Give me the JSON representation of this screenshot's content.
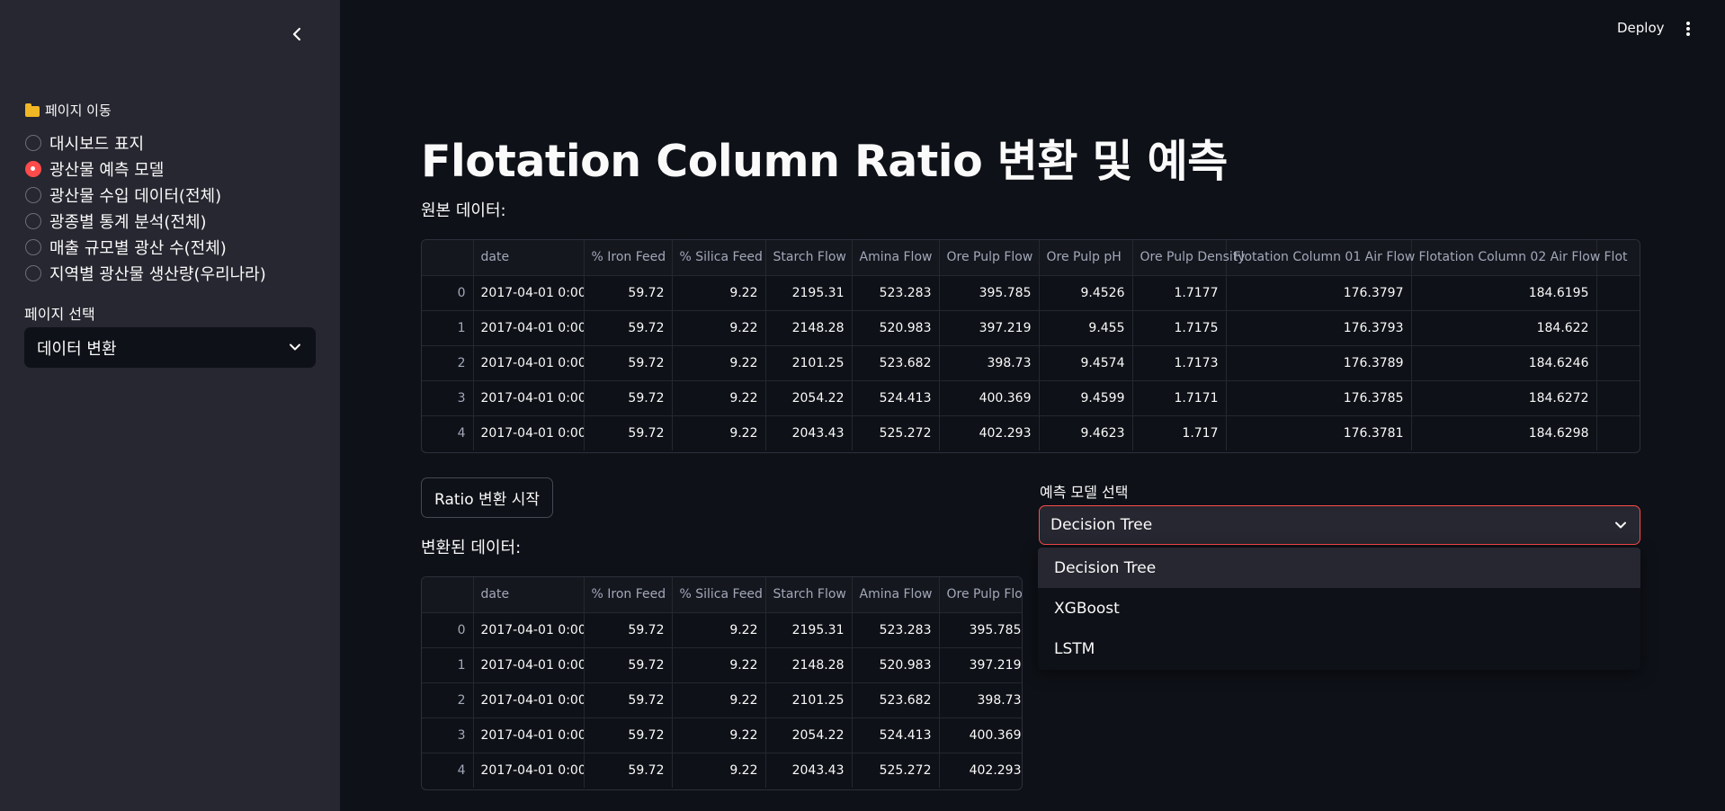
{
  "sidebar": {
    "nav_title": "페이지 이동",
    "radio_items": [
      {
        "label": "대시보드 표지",
        "selected": false
      },
      {
        "label": "광산물 예측 모델",
        "selected": true
      },
      {
        "label": "광산물 수입 데이터(전체)",
        "selected": false
      },
      {
        "label": "광종별 통계 분석(전체)",
        "selected": false
      },
      {
        "label": "매출 규모별 광산 수(전체)",
        "selected": false
      },
      {
        "label": "지역별 광산물 생산량(우리나라)",
        "selected": false
      }
    ],
    "page_select_label": "페이지 선택",
    "page_select_value": "데이터 변환"
  },
  "header": {
    "deploy_label": "Deploy"
  },
  "main": {
    "title": "Flotation Column Ratio 변환 및 예측",
    "original_label": "원본 데이터:",
    "original_table": {
      "columns": [
        "",
        "date",
        "% Iron Feed",
        "% Silica Feed",
        "Starch Flow",
        "Amina Flow",
        "Ore Pulp Flow",
        "Ore Pulp pH",
        "Ore Pulp Density",
        "Flotation Column 01 Air Flow",
        "Flotation Column 02 Air Flow",
        "Flot"
      ],
      "rows": [
        [
          "0",
          "2017-04-01 0:00",
          "59.72",
          "9.22",
          "2195.31",
          "523.283",
          "395.785",
          "9.4526",
          "1.7177",
          "176.3797",
          "184.6195",
          ""
        ],
        [
          "1",
          "2017-04-01 0:00",
          "59.72",
          "9.22",
          "2148.28",
          "520.983",
          "397.219",
          "9.455",
          "1.7175",
          "176.3793",
          "184.622",
          ""
        ],
        [
          "2",
          "2017-04-01 0:00",
          "59.72",
          "9.22",
          "2101.25",
          "523.682",
          "398.73",
          "9.4574",
          "1.7173",
          "176.3789",
          "184.6246",
          ""
        ],
        [
          "3",
          "2017-04-01 0:00",
          "59.72",
          "9.22",
          "2054.22",
          "524.413",
          "400.369",
          "9.4599",
          "1.7171",
          "176.3785",
          "184.6272",
          ""
        ],
        [
          "4",
          "2017-04-01 0:00",
          "59.72",
          "9.22",
          "2043.43",
          "525.272",
          "402.293",
          "9.4623",
          "1.717",
          "176.3781",
          "184.6298",
          ""
        ]
      ]
    },
    "ratio_button_label": "Ratio 변환 시작",
    "converted_label": "변환된 데이터:",
    "converted_table": {
      "columns": [
        "",
        "date",
        "% Iron Feed",
        "% Silica Feed",
        "Starch Flow",
        "Amina Flow",
        "Ore Pulp Flow"
      ],
      "rows": [
        [
          "0",
          "2017-04-01 0:00",
          "59.72",
          "9.22",
          "2195.31",
          "523.283",
          "395.785"
        ],
        [
          "1",
          "2017-04-01 0:00",
          "59.72",
          "9.22",
          "2148.28",
          "520.983",
          "397.219"
        ],
        [
          "2",
          "2017-04-01 0:00",
          "59.72",
          "9.22",
          "2101.25",
          "523.682",
          "398.73"
        ],
        [
          "3",
          "2017-04-01 0:00",
          "59.72",
          "9.22",
          "2054.22",
          "524.413",
          "400.369"
        ],
        [
          "4",
          "2017-04-01 0:00",
          "59.72",
          "9.22",
          "2043.43",
          "525.272",
          "402.293"
        ]
      ]
    },
    "model_select_label": "예측 모델 선택",
    "model_select_value": "Decision Tree",
    "model_options": [
      "Decision Tree",
      "XGBoost",
      "LSTM"
    ]
  }
}
